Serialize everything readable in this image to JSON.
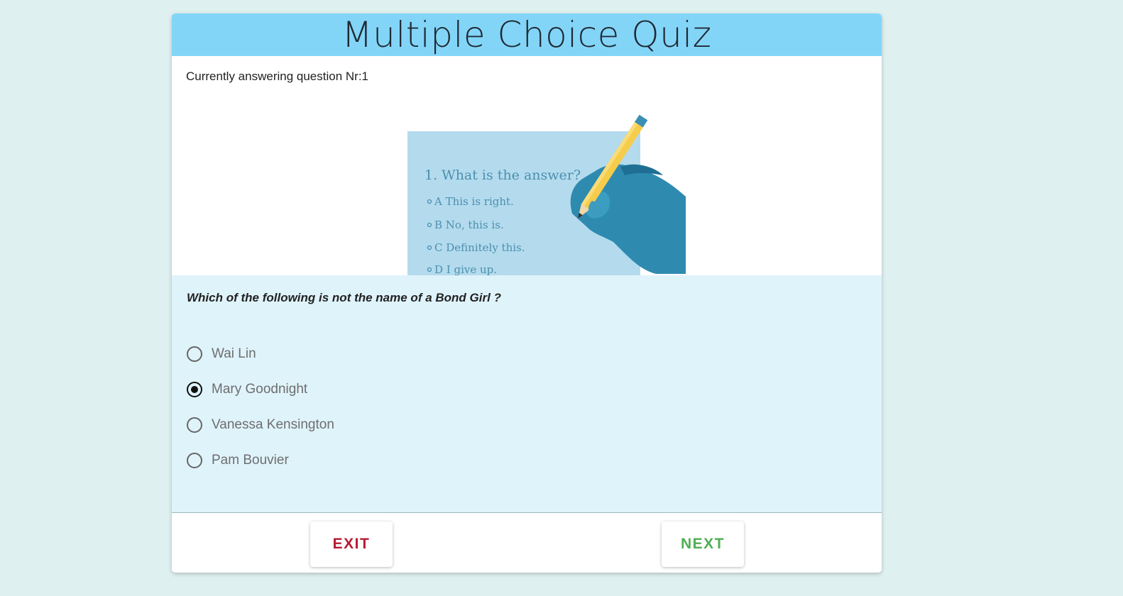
{
  "header": {
    "title": "Multiple Choice Quiz"
  },
  "status": {
    "text": "Currently answering question Nr:1"
  },
  "illustration": {
    "lines": [
      "1. What is the answer?",
      "A  This is right.",
      "B  No, this is.",
      "C  Definitely this.",
      "D  I give up."
    ]
  },
  "question": {
    "text": "Which of the following is not the name of a Bond Girl ?",
    "options": [
      {
        "label": "Wai Lin",
        "selected": false
      },
      {
        "label": "Mary Goodnight",
        "selected": true
      },
      {
        "label": "Vanessa Kensington",
        "selected": false
      },
      {
        "label": "Pam Bouvier",
        "selected": false
      }
    ]
  },
  "buttons": {
    "exit": "EXIT",
    "next": "NEXT"
  },
  "colors": {
    "background": "#dff0f0",
    "header": "#83d5f8",
    "question_panel": "#dff3fb",
    "exit": "#b51b33",
    "next": "#4fae55"
  }
}
